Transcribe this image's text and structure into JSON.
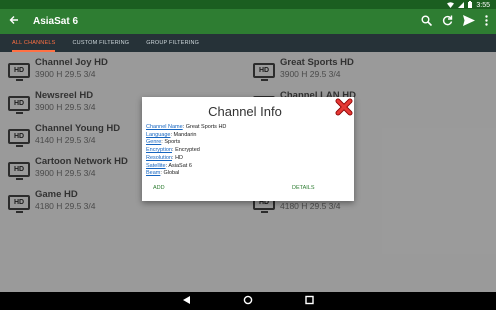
{
  "status_bar": {
    "time": "3:55"
  },
  "app_bar": {
    "title": "AsiaSat 6"
  },
  "tabs": [
    {
      "label": "All Channels"
    },
    {
      "label": "Custom Filtering"
    },
    {
      "label": "Group Filtering"
    }
  ],
  "channels_left": [
    {
      "icon": "HD",
      "name": "Channel Joy HD",
      "freq": "3900 H 29.5 3/4"
    },
    {
      "icon": "HD",
      "name": "Newsreel HD",
      "freq": "3900 H 29.5 3/4"
    },
    {
      "icon": "HD",
      "name": "Channel Young HD",
      "freq": "4140 H 29.5 3/4"
    },
    {
      "icon": "HD",
      "name": "Cartoon Network HD",
      "freq": "3900 H 29.5 3/4"
    },
    {
      "icon": "HD",
      "name": "Game HD",
      "freq": "4180 H 29.5 3/4"
    }
  ],
  "channels_right": [
    {
      "icon": "HD",
      "name": "Great Sports HD",
      "freq": "3900 H 29.5 3/4"
    },
    {
      "icon": "HD",
      "name": "Channel LAN HD",
      "freq": ""
    },
    {
      "icon": "HD",
      "name": "",
      "freq": ""
    },
    {
      "icon": "HD",
      "name": "",
      "freq": ""
    },
    {
      "icon": "HD",
      "name": "",
      "freq": "4180 H 29.5 3/4"
    }
  ],
  "dialog": {
    "title": "Channel Info",
    "fields": [
      {
        "key": "Channel Name",
        "value": "Great Sports HD"
      },
      {
        "key": "Language",
        "value": "Mandarin"
      },
      {
        "key": "Genre",
        "value": "Sports"
      },
      {
        "key": "Encryption",
        "value": "Encrypted"
      },
      {
        "key": "Resolution",
        "value": "HD"
      },
      {
        "key": "Satellite",
        "value": "AsiaSat 6"
      },
      {
        "key": "Beam",
        "value": "Global"
      }
    ],
    "add_label": "Add",
    "details_label": "Details"
  },
  "colors": {
    "appbar": "#2e7d32",
    "statusbar": "#1b5e20",
    "tabbar": "#263238",
    "tab_active": "#ff7043",
    "link": "#1565c0"
  }
}
